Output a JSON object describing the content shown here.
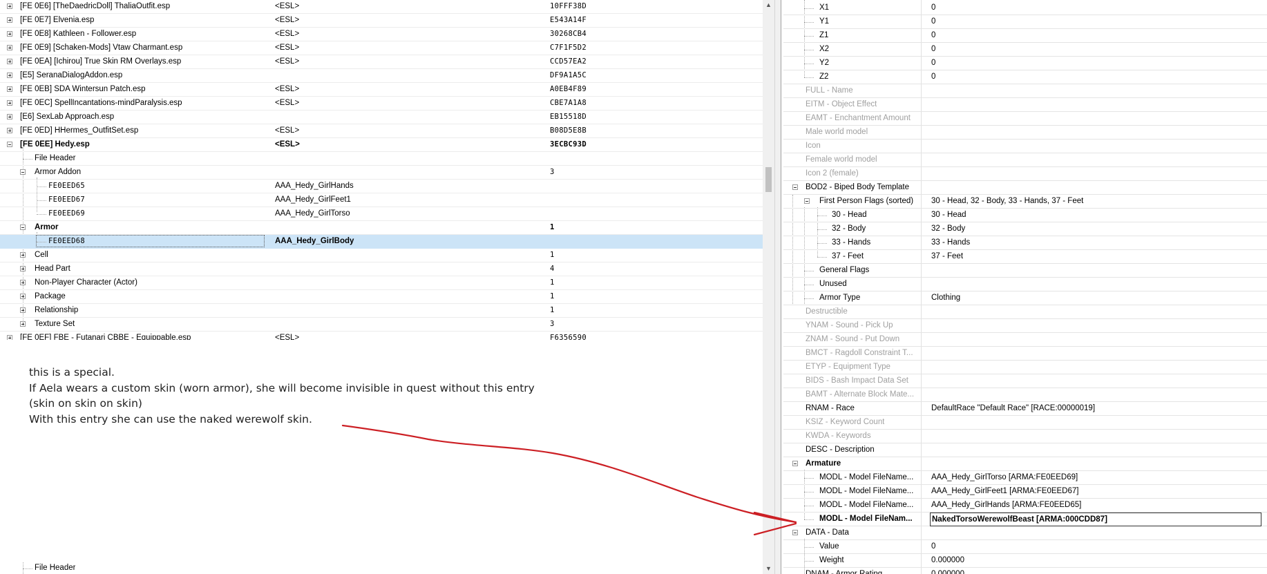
{
  "left_tree": {
    "rows": [
      {
        "name": "[FE 0E6] [TheDaedricDoll] ThaliaOutfit.esp",
        "col2": "<ESL>",
        "col3": "10FFF38D"
      },
      {
        "name": "[FE 0E7] Elvenia.esp",
        "col2": "<ESL>",
        "col3": "E543A14F"
      },
      {
        "name": "[FE 0E8] Kathleen - Follower.esp",
        "col2": "<ESL>",
        "col3": "30268CB4"
      },
      {
        "name": "[FE 0E9] [Schaken-Mods] Vtaw Charmant.esp",
        "col2": "<ESL>",
        "col3": "C7F1F5D2"
      },
      {
        "name": "[FE 0EA] [Ichirou] True Skin RM Overlays.esp",
        "col2": "<ESL>",
        "col3": "CCD57EA2"
      },
      {
        "name": "[E5] SeranaDialogAddon.esp",
        "col2": "",
        "col3": "DF9A1A5C"
      },
      {
        "name": "[FE 0EB] SDA Wintersun Patch.esp",
        "col2": "<ESL>",
        "col3": "A0EB4F89"
      },
      {
        "name": "[FE 0EC] SpellIncantations-mindParalysis.esp",
        "col2": "<ESL>",
        "col3": "CBE7A1A8"
      },
      {
        "name": "[E6] SexLab Approach.esp",
        "col2": "",
        "col3": "EB15518D"
      },
      {
        "name": "[FE 0ED] HHermes_OutfitSet.esp",
        "col2": "<ESL>",
        "col3": "B08D5E8B"
      },
      {
        "name": "[FE 0EE] Hedy.esp",
        "col2": "<ESL>",
        "col3": "3ECBC93D"
      },
      {
        "name": "File Header",
        "col2": "",
        "col3": ""
      },
      {
        "name": "Armor Addon",
        "col2": "",
        "col3": "3"
      },
      {
        "name": "FE0EED65",
        "col2": "AAA_Hedy_GirlHands",
        "col3": ""
      },
      {
        "name": "FE0EED67",
        "col2": "AAA_Hedy_GirlFeet1",
        "col3": ""
      },
      {
        "name": "FE0EED69",
        "col2": "AAA_Hedy_GirlTorso",
        "col3": ""
      },
      {
        "name": "Armor",
        "col2": "",
        "col3": "1"
      },
      {
        "name": "FE0EED68",
        "col2": "AAA_Hedy_GirlBody",
        "col3": ""
      },
      {
        "name": "Cell",
        "col2": "",
        "col3": "1"
      },
      {
        "name": "Head Part",
        "col2": "",
        "col3": "4"
      },
      {
        "name": "Non-Player Character (Actor)",
        "col2": "",
        "col3": "1"
      },
      {
        "name": "Package",
        "col2": "",
        "col3": "1"
      },
      {
        "name": "Relationship",
        "col2": "",
        "col3": "1"
      },
      {
        "name": "Texture Set",
        "col2": "",
        "col3": "3"
      },
      {
        "name": "[FE 0EF] FBE - Futanari CBBE - Equippable.esp",
        "col2": "<ESL>",
        "col3": "F6356590"
      }
    ],
    "bottom_row": "File Header"
  },
  "right_tree": {
    "rows": [
      {
        "name": "X1",
        "value": "0"
      },
      {
        "name": "Y1",
        "value": "0"
      },
      {
        "name": "Z1",
        "value": "0"
      },
      {
        "name": "X2",
        "value": "0"
      },
      {
        "name": "Y2",
        "value": "0"
      },
      {
        "name": "Z2",
        "value": "0"
      },
      {
        "name": "FULL - Name",
        "value": ""
      },
      {
        "name": "EITM - Object Effect",
        "value": ""
      },
      {
        "name": "EAMT - Enchantment Amount",
        "value": ""
      },
      {
        "name": "Male world model",
        "value": ""
      },
      {
        "name": "Icon",
        "value": ""
      },
      {
        "name": "Female world model",
        "value": ""
      },
      {
        "name": "Icon 2 (female)",
        "value": ""
      },
      {
        "name": "BOD2 - Biped Body Template",
        "value": ""
      },
      {
        "name": "First Person Flags (sorted)",
        "value": "30 - Head, 32 - Body, 33 - Hands, 37 - Feet"
      },
      {
        "name": "30 - Head",
        "value": "30 - Head"
      },
      {
        "name": "32 - Body",
        "value": "32 - Body"
      },
      {
        "name": "33 - Hands",
        "value": "33 - Hands"
      },
      {
        "name": "37 - Feet",
        "value": "37 - Feet"
      },
      {
        "name": "General Flags",
        "value": ""
      },
      {
        "name": "Unused",
        "value": ""
      },
      {
        "name": "Armor Type",
        "value": "Clothing"
      },
      {
        "name": "Destructible",
        "value": ""
      },
      {
        "name": "YNAM - Sound - Pick Up",
        "value": ""
      },
      {
        "name": "ZNAM - Sound - Put Down",
        "value": ""
      },
      {
        "name": "BMCT - Ragdoll Constraint T...",
        "value": ""
      },
      {
        "name": "ETYP - Equipment Type",
        "value": ""
      },
      {
        "name": "BIDS - Bash Impact Data Set",
        "value": ""
      },
      {
        "name": "BAMT - Alternate Block Mate...",
        "value": ""
      },
      {
        "name": "RNAM - Race",
        "value": "DefaultRace \"Default Race\" [RACE:00000019]"
      },
      {
        "name": "KSIZ - Keyword Count",
        "value": ""
      },
      {
        "name": "KWDA - Keywords",
        "value": ""
      },
      {
        "name": "DESC - Description",
        "value": ""
      },
      {
        "name": "Armature",
        "value": ""
      },
      {
        "name": "MODL - Model FileName...",
        "value": "AAA_Hedy_GirlTorso [ARMA:FE0EED69]"
      },
      {
        "name": "MODL - Model FileName...",
        "value": "AAA_Hedy_GirlFeet1 [ARMA:FE0EED67]"
      },
      {
        "name": "MODL - Model FileName...",
        "value": "AAA_Hedy_GirlHands [ARMA:FE0EED65]"
      },
      {
        "name": "MODL - Model FileNam...",
        "value": "NakedTorsoWerewolfBeast [ARMA:000CDD87]"
      },
      {
        "name": "DATA - Data",
        "value": ""
      },
      {
        "name": "Value",
        "value": "0"
      },
      {
        "name": "Weight",
        "value": "0.000000"
      },
      {
        "name": "DNAM - Armor Rating",
        "value": "0.000000"
      }
    ]
  },
  "annotation": {
    "lines": [
      "this is a special.",
      "If Aela wears a custom skin (worn armor), she will become invisible in quest without this entry",
      "(skin on skin on skin)",
      "With this entry she can use the naked werewolf skin."
    ],
    "arrow_color": "#cc1f24"
  },
  "colors": {
    "selection": "#cce4f7",
    "disabled_text": "#a0a0a0"
  }
}
